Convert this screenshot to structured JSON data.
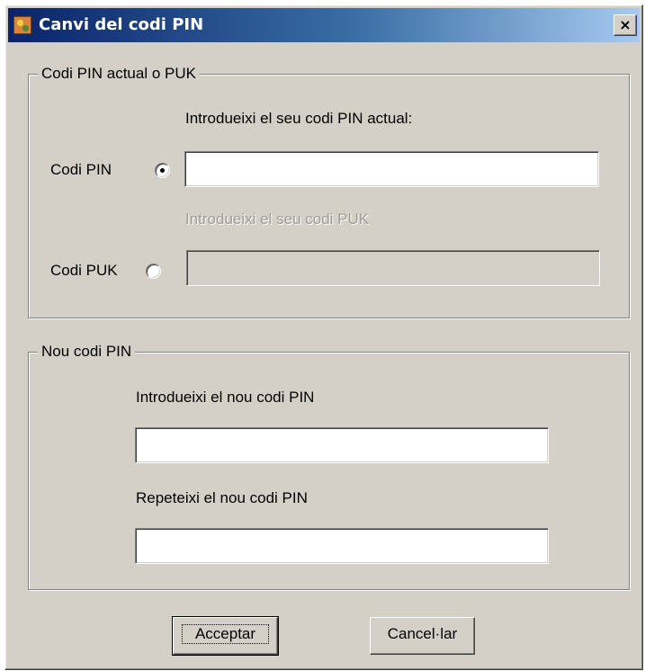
{
  "window": {
    "title": "Canvi del codi PIN",
    "close_label": "×"
  },
  "current_group": {
    "legend": "Codi PIN actual o PUK",
    "pin_prompt": "Introdueixi el seu codi PIN actual:",
    "pin_label": "Codi PIN",
    "pin_value": "",
    "pin_selected": true,
    "puk_prompt": "Introdueixi el seu codi PUK",
    "puk_label": "Codi PUK",
    "puk_value": "",
    "puk_selected": false
  },
  "new_group": {
    "legend": "Nou codi PIN",
    "new_prompt": "Introdueixi el nou codi PIN",
    "new_value": "",
    "repeat_prompt": "Repeteixi el nou codi PIN",
    "repeat_value": ""
  },
  "buttons": {
    "accept_label": "Acceptar",
    "cancel_label": "Cancel·lar"
  },
  "colors": {
    "dialog_face": "#d4d0c8",
    "titlebar_start": "#0a246a",
    "titlebar_end": "#a6caf0",
    "disabled_text": "#a09c94"
  }
}
